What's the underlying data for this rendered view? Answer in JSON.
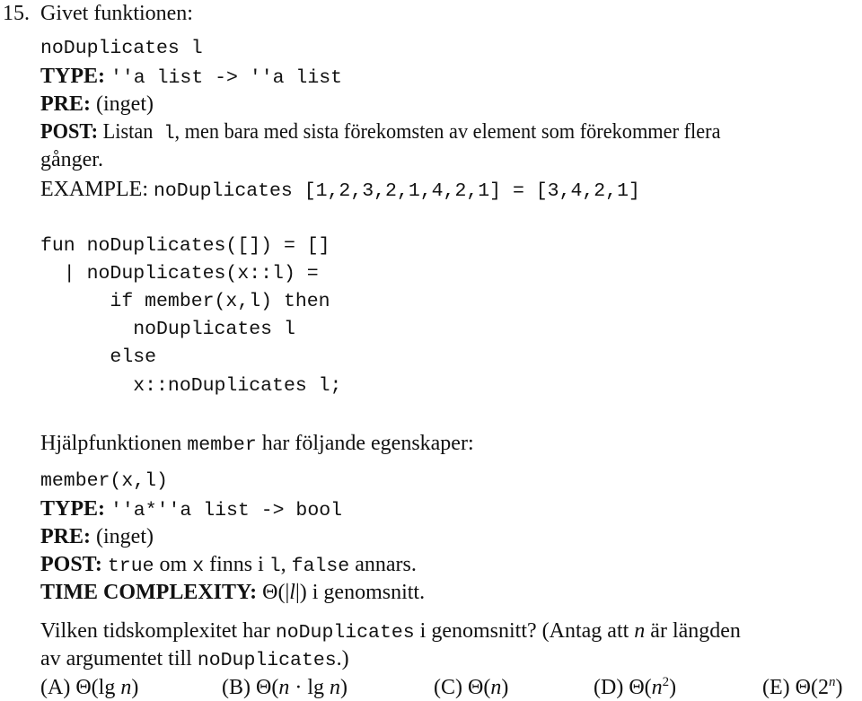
{
  "problem": {
    "number": "15.",
    "intro": "Givet funktionen:"
  },
  "spec": {
    "signature": "noDuplicates l",
    "type_label": "TYPE:",
    "type_value": "''a list -> ''a list",
    "pre_label": "PRE:",
    "pre_value": "(inget)",
    "post_label": "POST:",
    "post_text_1": "Listan",
    "post_code": "l",
    "post_text_2": ", men bara med sista förekomsten av element som förekommer flera",
    "post_text_3": "gånger.",
    "example_label": "EXAMPLE:",
    "example_value": "noDuplicates [1,2,3,2,1,4,2,1] = [3,4,2,1]"
  },
  "code": {
    "lines": [
      "fun noDuplicates([]) = []",
      "  | noDuplicates(x::l) =",
      "      if member(x,l) then",
      "        noDuplicates l",
      "      else",
      "        x::noDuplicates l;"
    ]
  },
  "helper": {
    "intro_1": "Hjälpfunktionen",
    "intro_code": "member",
    "intro_2": "har följande egenskaper:",
    "signature": "member(x,l)",
    "type_label": "TYPE:",
    "type_value": "''a*''a list -> bool",
    "pre_label": "PRE:",
    "pre_value": "(inget)",
    "post_label": "POST:",
    "post_true": "true",
    "post_text_1": "om",
    "post_x": "x",
    "post_text_2": "finns i",
    "post_l": "l",
    "post_comma": ",",
    "post_false": "false",
    "post_text_3": "annars.",
    "time_label": "TIME COMPLEXITY:",
    "time_theta": "Θ(|",
    "time_var": "l",
    "time_close": "|)",
    "time_text": "i genomsnitt."
  },
  "question": {
    "text_1": "Vilken tidskomplexitet har",
    "code_1": "noDuplicates",
    "text_2": "i genomsnitt? (Antag att",
    "var_n": "n",
    "text_3": "är längden",
    "text_4": "av argumentet till",
    "code_2": "noDuplicates",
    "text_5": ".)"
  },
  "options": [
    {
      "label": "(A)",
      "pre": "Θ(lg ",
      "var": "n",
      "post": ")",
      "sup": ""
    },
    {
      "label": "(B)",
      "pre": "Θ(",
      "var": "n",
      "post": " · lg ",
      "var2": "n",
      "post2": ")",
      "sup": ""
    },
    {
      "label": "(C)",
      "pre": "Θ(",
      "var": "n",
      "post": ")",
      "sup": ""
    },
    {
      "label": "(D)",
      "pre": "Θ(",
      "var": "n",
      "sup": "2",
      "post": ")"
    },
    {
      "label": "(E)",
      "pre": "Θ(2",
      "var": "",
      "sup": "n",
      "post": ")"
    }
  ]
}
